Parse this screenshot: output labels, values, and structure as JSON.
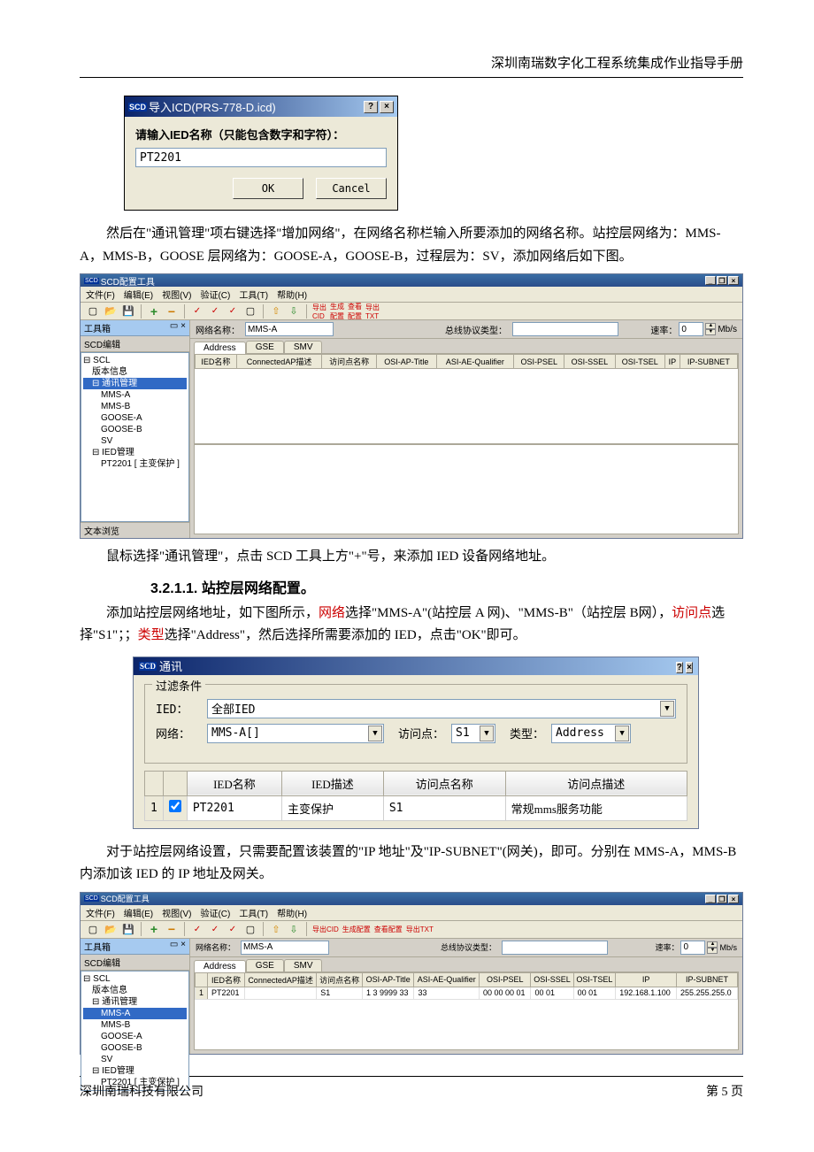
{
  "doc": {
    "header_title": "深圳南瑞数字化工程系统集成作业指导手册",
    "footer_company": "深圳南瑞科技有限公司",
    "footer_page": "第 5 页"
  },
  "dlg_icd": {
    "title": "导入ICD(PRS-778-D.icd)",
    "label": "请输入IED名称（只能包含数字和字符）：",
    "value": "PT2201",
    "ok": "OK",
    "cancel": "Cancel"
  },
  "para1a": "然后在\"通讯管理\"项右键选择\"增加网络\"，在网络名称栏输入所要添加的网络名称。站控层网络为：MMS-A，MMS-B，GOOSE 层网络为：GOOSE-A，GOOSE-B，过程层为：SV，添加网络后如下图。",
  "app1": {
    "title": "SCD配置工具",
    "menus": [
      "文件(F)",
      "编辑(E)",
      "视图(V)",
      "验证(C)",
      "工具(T)",
      "帮助(H)"
    ],
    "side_hd": "工具箱",
    "side_hd2": "SCD编辑",
    "side_ft": "文本浏览",
    "tree": [
      {
        "t": "⊟ SCL",
        "l": 0
      },
      {
        "t": "版本信息",
        "l": 1
      },
      {
        "t": "⊟ 通讯管理",
        "l": 1,
        "sel": true
      },
      {
        "t": "MMS-A",
        "l": 2
      },
      {
        "t": "MMS-B",
        "l": 2
      },
      {
        "t": "GOOSE-A",
        "l": 2
      },
      {
        "t": "GOOSE-B",
        "l": 2
      },
      {
        "t": "SV",
        "l": 2
      },
      {
        "t": "⊟ IED管理",
        "l": 1
      },
      {
        "t": "PT2201 [ 主变保护 ]",
        "l": 2
      }
    ],
    "netname_lbl": "网络名称：",
    "netname": "MMS-A",
    "bustype_lbl": "总线协议类型：",
    "rate_lbl": "速率：",
    "rate": "0",
    "rate_unit": "Mb/s",
    "tabs": [
      "Address",
      "GSE",
      "SMV"
    ],
    "cols": [
      "IED名称",
      "ConnectedAP描述",
      "访问点名称",
      "OSI-AP-Title",
      "ASI-AE-Qualifier",
      "OSI-PSEL",
      "OSI-SSEL",
      "OSI-TSEL",
      "IP",
      "IP-SUBNET"
    ]
  },
  "para1b": "鼠标选择\"通讯管理\"，点击 SCD 工具上方\"+\"号，来添加 IED 设备网络地址。",
  "section_title": "3.2.1.1. 站控层网络配置。",
  "para2a_1": "添加站控层网络地址，如下图所示，",
  "para2a_2": "网络",
  "para2a_3": "选择\"MMS-A\"(站控层 A 网)、\"MMS-B\"（站控层 B网），",
  "para2a_4": "访问点",
  "para2a_5": "选择\"S1\"；；",
  "para2a_6": "类型",
  "para2a_7": "选择\"Address\"，然后选择所需要添加的 IED，点击\"OK\"即可。",
  "comm": {
    "title": "通讯",
    "legend": "过滤条件",
    "ied_lbl": "IED：",
    "ied": "全部IED",
    "net_lbl": "网络：",
    "net": "MMS-A[]",
    "ap_lbl": "访问点：",
    "ap": "S1",
    "type_lbl": "类型：",
    "type": "Address",
    "cols": [
      "IED名称",
      "IED描述",
      "访问点名称",
      "访问点描述"
    ],
    "row": {
      "n": "1",
      "ied": "PT2201",
      "desc": "主变保护",
      "ap": "S1",
      "apdesc": "常规mms服务功能",
      "checked": true
    }
  },
  "para3": "对于站控层网络设置，只需要配置该装置的\"IP 地址\"及\"IP-SUBNET\"(网关)，即可。分别在 MMS-A，MMS-B 内添加该 IED 的 IP 地址及网关。",
  "app2": {
    "tree": [
      {
        "t": "⊟ SCL",
        "l": 0
      },
      {
        "t": "版本信息",
        "l": 1
      },
      {
        "t": "⊟ 通讯管理",
        "l": 1
      },
      {
        "t": "MMS-A",
        "l": 2,
        "sel": true
      },
      {
        "t": "MMS-B",
        "l": 2
      },
      {
        "t": "GOOSE-A",
        "l": 2
      },
      {
        "t": "GOOSE-B",
        "l": 2
      },
      {
        "t": "SV",
        "l": 2
      },
      {
        "t": "⊟ IED管理",
        "l": 1
      },
      {
        "t": "PT2201 [ 主变保护 ]",
        "l": 2
      }
    ],
    "row": {
      "ied": "PT2201",
      "ap": "S1",
      "title": "1 3 9999 33",
      "qual": "33",
      "psel": "00 00 00 01",
      "ssel": "00 01",
      "tsel": "00 01",
      "ip": "192.168.1.100",
      "sub": "255.255.255.0"
    }
  }
}
